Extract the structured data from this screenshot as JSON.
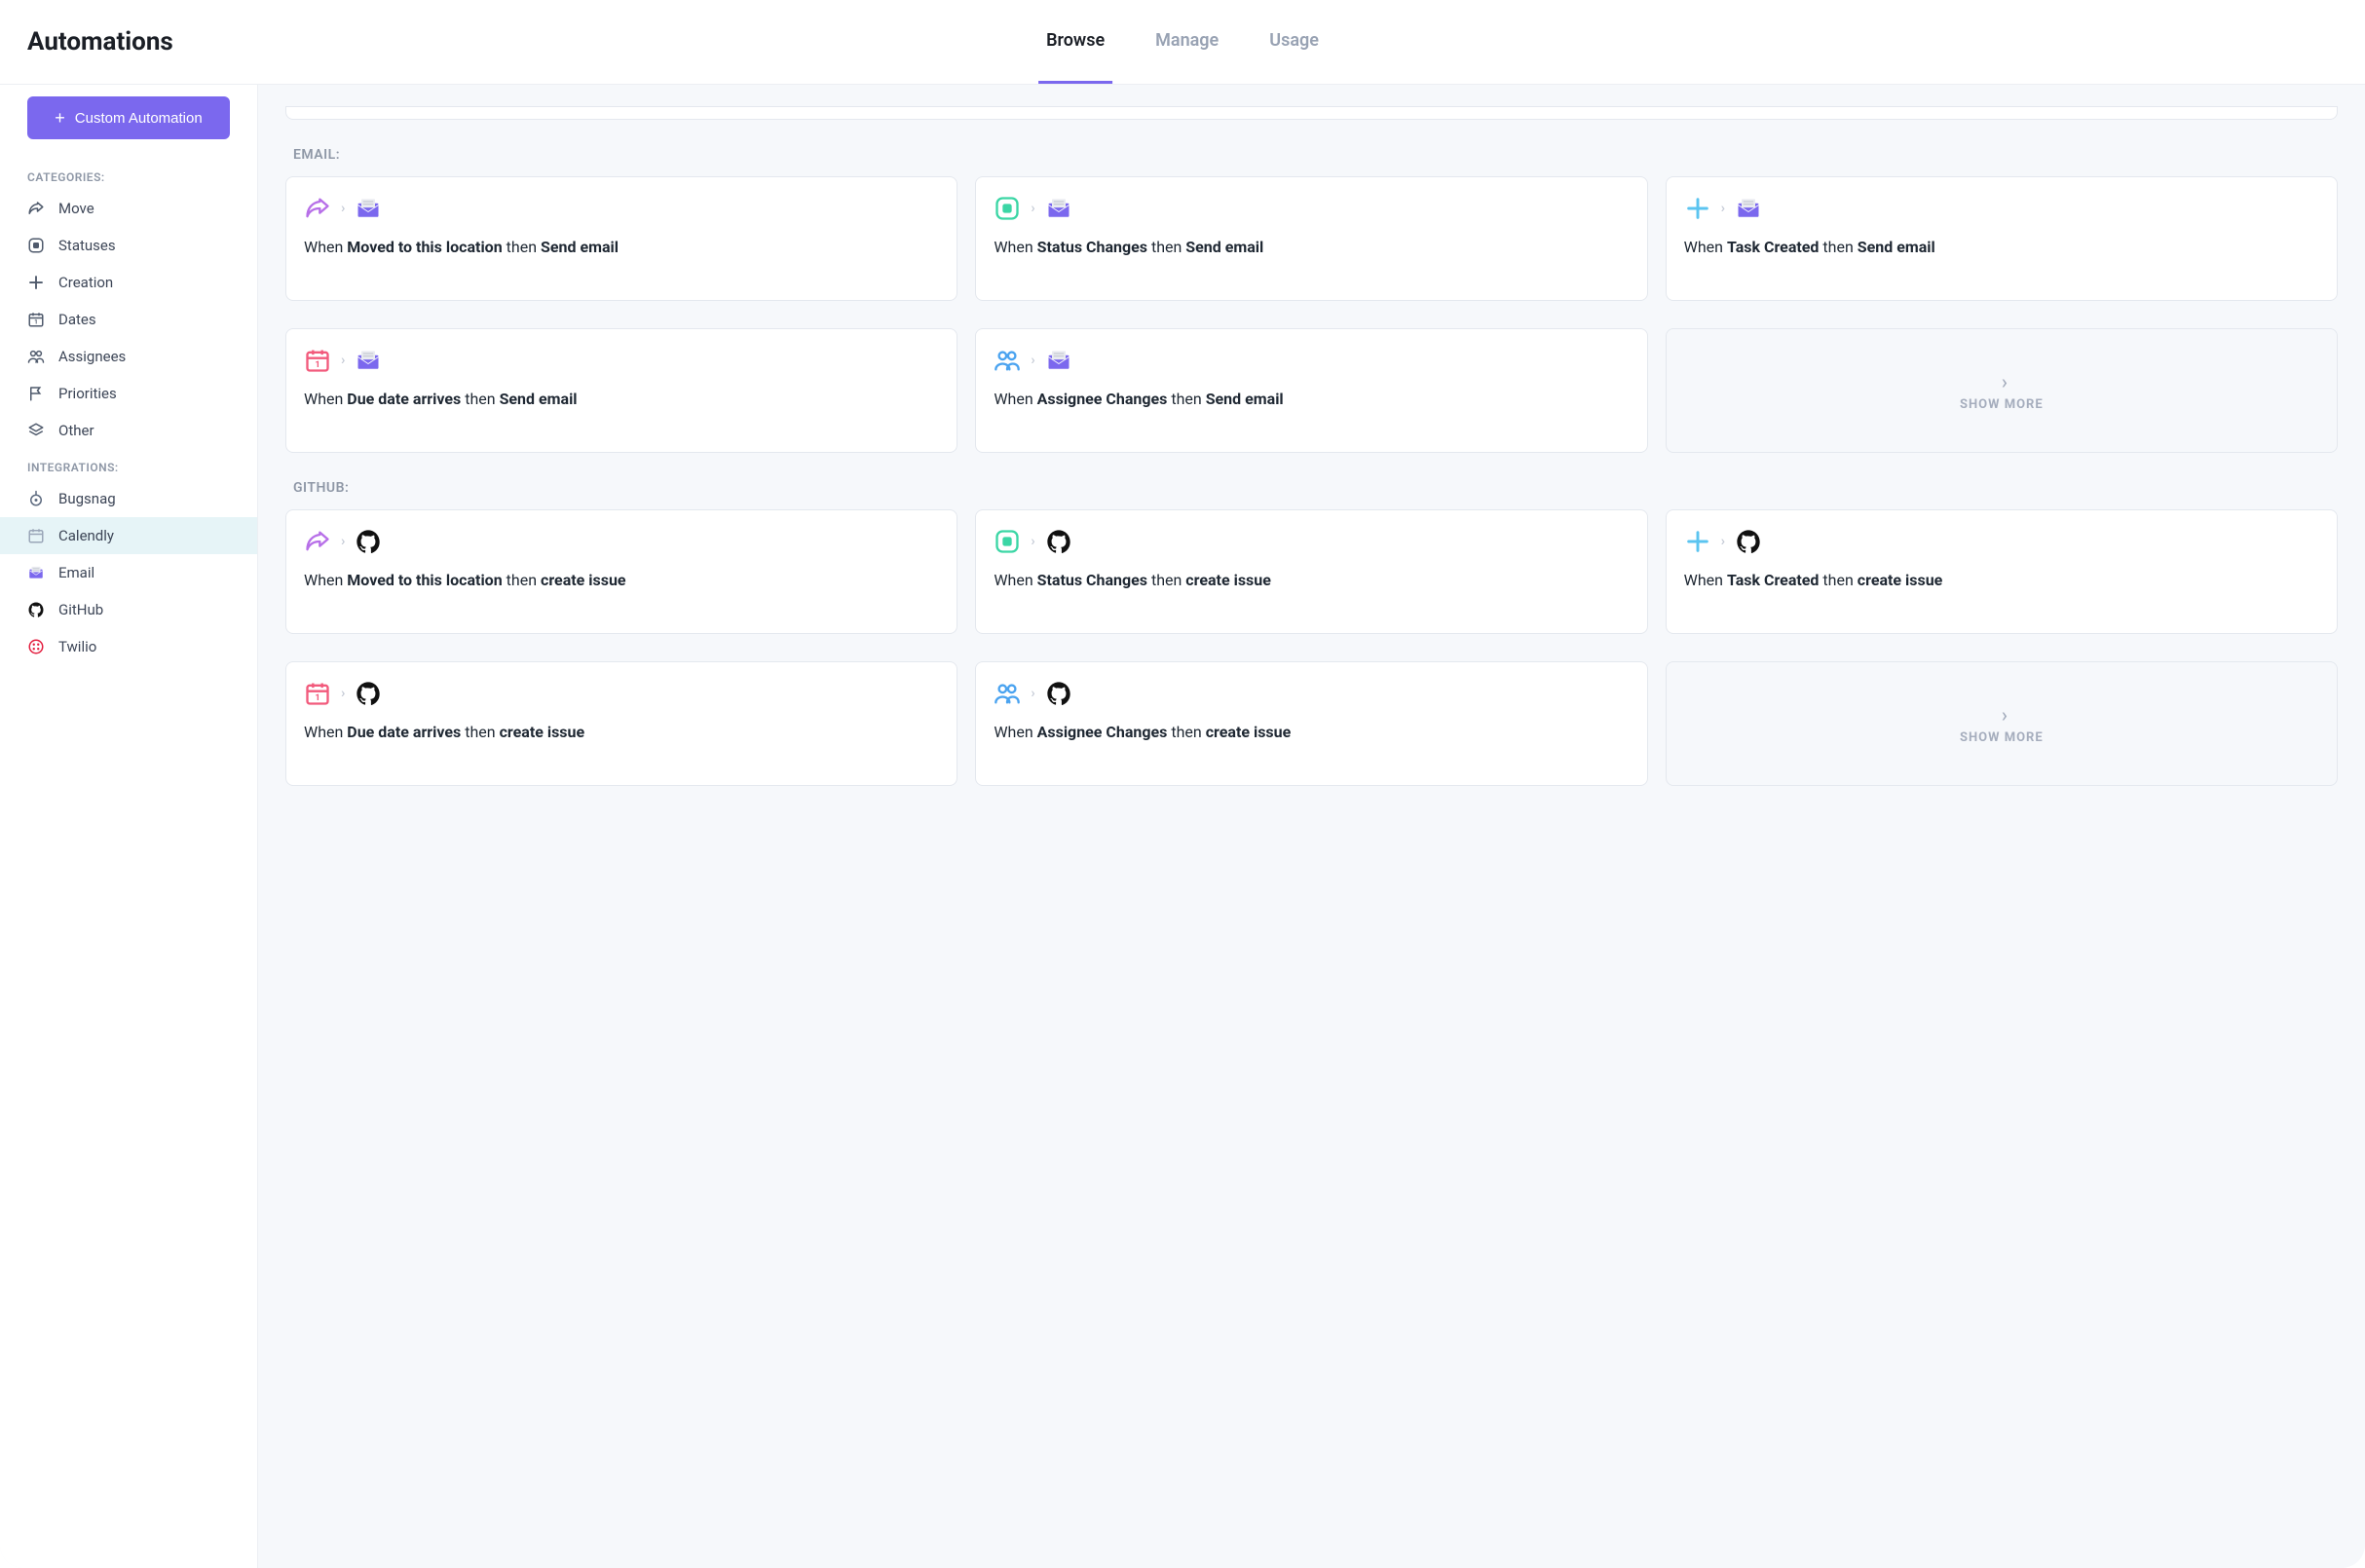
{
  "header": {
    "title": "Automations",
    "tabs": [
      {
        "label": "Browse",
        "active": true
      },
      {
        "label": "Manage",
        "active": false
      },
      {
        "label": "Usage",
        "active": false
      }
    ]
  },
  "sidebar": {
    "custom_button": "Custom Automation",
    "categories_heading": "CATEGORIES:",
    "categories": [
      {
        "label": "Move",
        "icon": "share-arrow"
      },
      {
        "label": "Statuses",
        "icon": "status-square"
      },
      {
        "label": "Creation",
        "icon": "plus-cross"
      },
      {
        "label": "Dates",
        "icon": "calendar"
      },
      {
        "label": "Assignees",
        "icon": "assignees"
      },
      {
        "label": "Priorities",
        "icon": "flag"
      },
      {
        "label": "Other",
        "icon": "layers"
      }
    ],
    "integrations_heading": "INTEGRATIONS:",
    "integrations": [
      {
        "label": "Bugsnag",
        "icon": "bugsnag",
        "color": "#5e6b80"
      },
      {
        "label": "Calendly",
        "icon": "calendly",
        "color": "#9aa6b8",
        "active": true
      },
      {
        "label": "Email",
        "icon": "email",
        "color": "#7b68ee"
      },
      {
        "label": "GitHub",
        "icon": "github",
        "color": "#111111"
      },
      {
        "label": "Twilio",
        "icon": "twilio",
        "color": "#e31e3f"
      }
    ]
  },
  "sections": [
    {
      "heading": "EMAIL:",
      "action_icon": "email",
      "cards": [
        {
          "trigger_icon": "share-arrow",
          "trigger_color": "#b76fe8",
          "trigger_label": "Moved to this location",
          "action_label": "Send email"
        },
        {
          "trigger_icon": "status-square",
          "trigger_color": "#3bd6a5",
          "trigger_label": "Status Changes",
          "action_label": "Send email"
        },
        {
          "trigger_icon": "plus-cross",
          "trigger_color": "#5bc4f0",
          "trigger_label": "Task Created",
          "action_label": "Send email"
        },
        {
          "trigger_icon": "calendar",
          "trigger_color": "#f25a7c",
          "trigger_label": "Due date arrives",
          "action_label": "Send email"
        },
        {
          "trigger_icon": "assignees",
          "trigger_color": "#4aa3f0",
          "trigger_label": "Assignee Changes",
          "action_label": "Send email"
        }
      ],
      "show_more": "SHOW MORE"
    },
    {
      "heading": "GITHUB:",
      "action_icon": "github",
      "cards": [
        {
          "trigger_icon": "share-arrow",
          "trigger_color": "#b76fe8",
          "trigger_label": "Moved to this location",
          "action_label": "create issue"
        },
        {
          "trigger_icon": "status-square",
          "trigger_color": "#3bd6a5",
          "trigger_label": "Status Changes",
          "action_label": "create issue"
        },
        {
          "trigger_icon": "plus-cross",
          "trigger_color": "#5bc4f0",
          "trigger_label": "Task Created",
          "action_label": "create issue"
        },
        {
          "trigger_icon": "calendar",
          "trigger_color": "#f25a7c",
          "trigger_label": "Due date arrives",
          "action_label": "create issue"
        },
        {
          "trigger_icon": "assignees",
          "trigger_color": "#4aa3f0",
          "trigger_label": "Assignee Changes",
          "action_label": "create issue"
        }
      ],
      "show_more": "SHOW MORE"
    }
  ],
  "text": {
    "when": "When ",
    "then": " then "
  }
}
